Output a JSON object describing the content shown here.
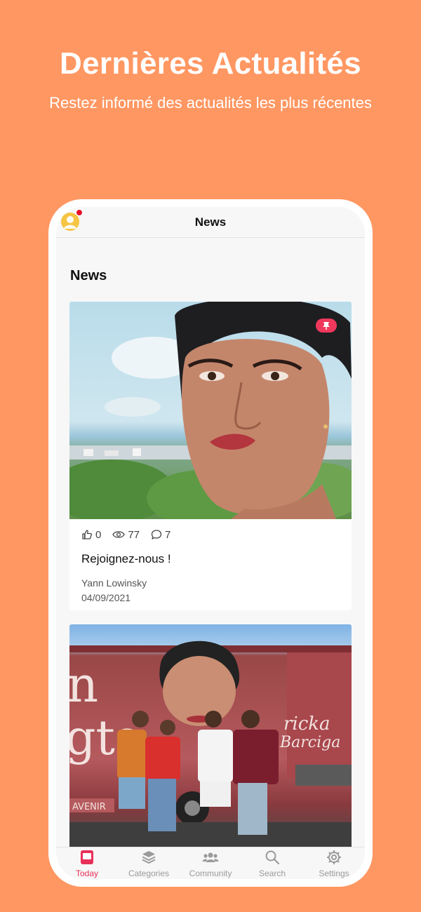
{
  "promo": {
    "headline": "Dernières Actualités",
    "subline": "Restez informé des actualités les plus récentes"
  },
  "header": {
    "title": "News",
    "avatar_icon": "user-avatar-icon",
    "has_notification": true
  },
  "section": {
    "title": "News"
  },
  "articles": [
    {
      "image": "portrait-woman-short-hair-city-background",
      "pinned": true,
      "likes": "0",
      "views": "77",
      "comments": "7",
      "title": "Rejoignez-nous !",
      "author": "Yann Lowinsky",
      "date": "04/09/2021"
    },
    {
      "image": "group-photo-masked-men-in-front-of-red-campaign-bus",
      "pinned": false
    }
  ],
  "tabbar": {
    "items": [
      {
        "label": "Today",
        "icon": "today-icon",
        "active": true
      },
      {
        "label": "Categories",
        "icon": "categories-icon",
        "active": false
      },
      {
        "label": "Community",
        "icon": "community-icon",
        "active": false
      },
      {
        "label": "Search",
        "icon": "search-icon",
        "active": false
      },
      {
        "label": "Settings",
        "icon": "settings-icon",
        "active": false
      }
    ]
  },
  "colors": {
    "background": "#FF9762",
    "accent": "#E8315A",
    "pin_badge": "#F0385C",
    "notification": "#E8102A",
    "avatar": "#F6C544"
  }
}
